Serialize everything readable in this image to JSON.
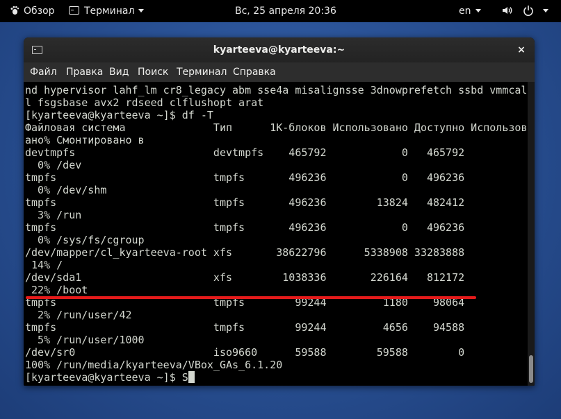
{
  "topbar": {
    "activities": "Обзор",
    "app_menu": "Терминал",
    "clock": "Вс, 25 апреля  20:36",
    "keyboard_layout": "en",
    "icons": [
      "volume-icon",
      "power-icon"
    ]
  },
  "window": {
    "title": "kyarteeva@kyarteeva:~",
    "close": "×",
    "menu": [
      "Файл",
      "Правка",
      "Вид",
      "Поиск",
      "Терминал",
      "Справка"
    ]
  },
  "terminal": {
    "lines": [
      "nd hypervisor lahf_lm cr8_legacy abm sse4a misalignsse 3dnowprefetch ssbd vmmcal",
      "l fsgsbase avx2 rdseed clflushopt arat",
      "[kyarteeva@kyarteeva ~]$ df -T",
      "Файловая система              Тип      1K-блоков Использовано Доступно Использов",
      "ано% Смонтировано в",
      "devtmpfs                      devtmpfs    465792            0   465792",
      "  0% /dev",
      "tmpfs                         tmpfs       496236            0   496236",
      "  0% /dev/shm",
      "tmpfs                         tmpfs       496236        13824   482412",
      "  3% /run",
      "tmpfs                         tmpfs       496236            0   496236",
      "  0% /sys/fs/cgroup",
      "/dev/mapper/cl_kyarteeva-root xfs       38622796      5338908 33283888",
      " 14% /",
      "/dev/sda1                     xfs        1038336       226164   812172",
      " 22% /boot",
      "tmpfs                         tmpfs        99244         1180    98064",
      "  2% /run/user/42",
      "tmpfs                         tmpfs        99244         4656    94588",
      "  5% /run/user/1000",
      "/dev/sr0                      iso9660      59588        59588        0",
      "100% /run/media/kyarteeva/VBox_GAs_6.1.20"
    ],
    "prompt_line": "[kyarteeva@kyarteeva ~]$ S",
    "colors": {
      "background": "#000000",
      "foreground": "#d3d7cf",
      "annotation": "#e41a1a"
    }
  }
}
